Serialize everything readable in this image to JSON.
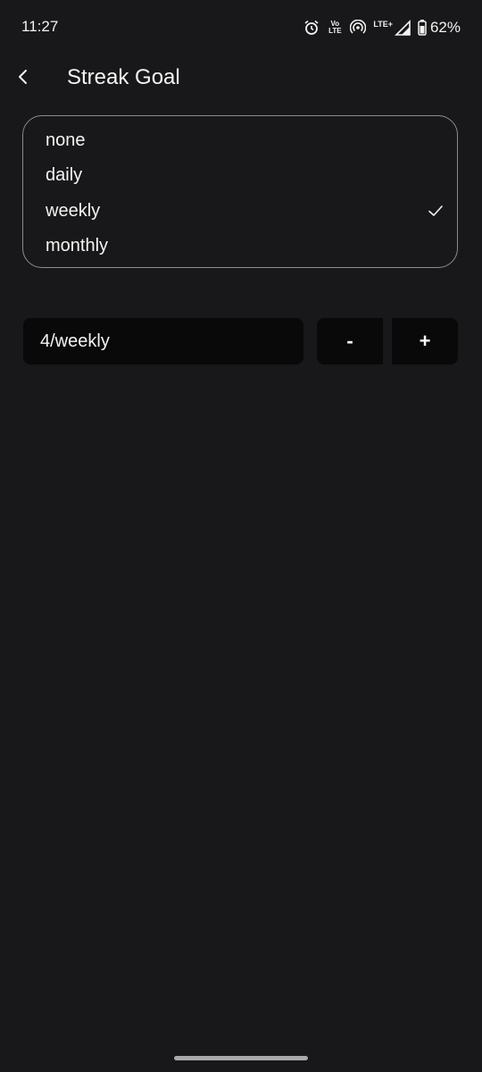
{
  "status_bar": {
    "time": "11:27",
    "volte_top": "Vo",
    "volte_bottom": "LTE",
    "network": "LTE+",
    "battery": "62%",
    "icons": [
      "alarm-icon",
      "volte-icon",
      "hotspot-icon",
      "signal-icon",
      "battery-icon"
    ]
  },
  "header": {
    "title": "Streak Goal",
    "back_icon": "chevron-left-icon"
  },
  "goal_options": {
    "items": [
      {
        "label": "none",
        "selected": false
      },
      {
        "label": "daily",
        "selected": false
      },
      {
        "label": "weekly",
        "selected": true
      },
      {
        "label": "monthly",
        "selected": false
      }
    ]
  },
  "goal_value": {
    "value": "4/weekly",
    "decrement_label": "-",
    "increment_label": "+"
  },
  "colors": {
    "background": "#18181a",
    "surface": "#09090a",
    "border": "#8c8c90",
    "text": "#f4f4f4"
  }
}
